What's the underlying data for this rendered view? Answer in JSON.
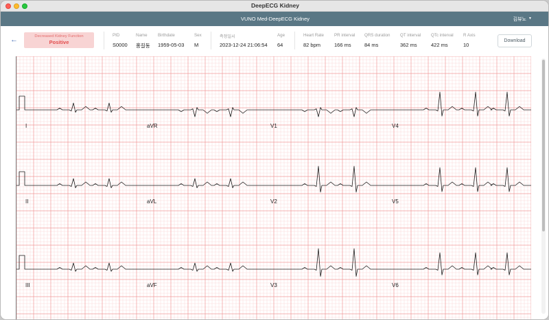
{
  "window": {
    "title": "DeepECG Kidney"
  },
  "appbar": {
    "title": "VUNO Med-DeepECG Kidney",
    "user": "김뷰노"
  },
  "result": {
    "label": "Decreased Kidney Function",
    "value": "Positive"
  },
  "patient": [
    {
      "label": "PID",
      "value": "S0000"
    },
    {
      "label": "Name",
      "value": "홍길동"
    },
    {
      "label": "Birthdate",
      "value": "1959-05-03"
    },
    {
      "label": "Sex",
      "value": "M"
    },
    {
      "label": "측정일시",
      "value": "2023-12-24 21:06:54"
    },
    {
      "label": "Age",
      "value": "64"
    }
  ],
  "measurements": [
    {
      "label": "Heart Rate",
      "value": "82 bpm"
    },
    {
      "label": "PR interval",
      "value": "166 ms"
    },
    {
      "label": "QRS duration",
      "value": "84 ms"
    },
    {
      "label": "QT interval",
      "value": "362 ms"
    },
    {
      "label": "QTc interval",
      "value": "422 ms"
    },
    {
      "label": "R Axis",
      "value": "10"
    }
  ],
  "actions": {
    "download": "Download"
  },
  "ecg": {
    "rows": [
      [
        "I",
        "aVR",
        "V1",
        "V4"
      ],
      [
        "II",
        "aVL",
        "V2",
        "V5"
      ],
      [
        "III",
        "aVF",
        "V3",
        "V6"
      ]
    ]
  },
  "colors": {
    "appbar": "#5a7785",
    "badge_bg": "#f8d4d4",
    "badge_text": "#e24d4d",
    "grid_major": "#f19a9a",
    "grid_minor": "#fbd8d8",
    "trace": "#1a1a1a"
  }
}
